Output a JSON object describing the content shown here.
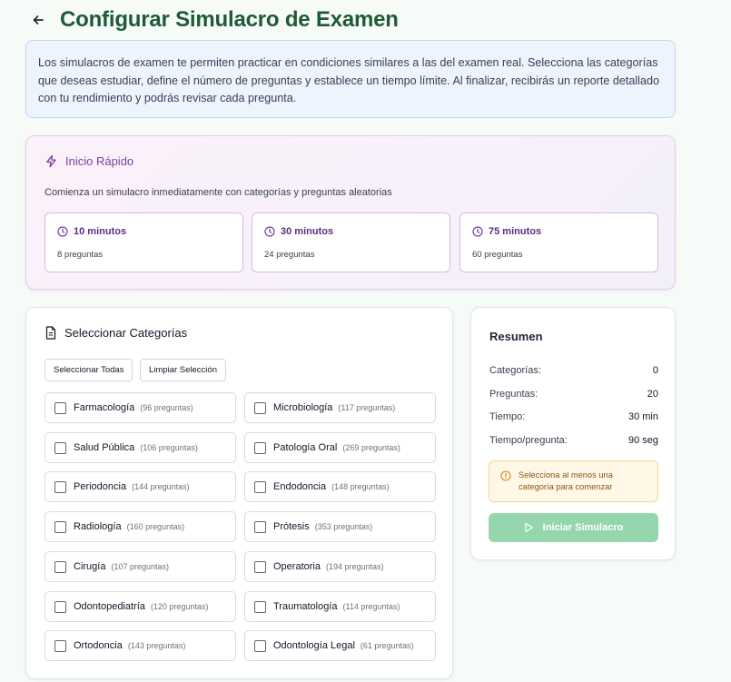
{
  "page": {
    "title": "Configurar Simulacro de Examen",
    "intro": "Los simulacros de examen te permiten practicar en condiciones similares a las del examen real. Selecciona las categorías que deseas estudiar, define el número de preguntas y establece un tiempo límite. Al finalizar, recibirás un reporte detallado con tu rendimiento y podrás revisar cada pregunta."
  },
  "quick_start": {
    "title": "Inicio Rápido",
    "subtitle": "Comienza un simulacro inmediatamente con categorías y preguntas aleatorias",
    "options": [
      {
        "label": "10 minutos",
        "questions": "8 preguntas"
      },
      {
        "label": "30 minutos",
        "questions": "24 preguntas"
      },
      {
        "label": "75 minutos",
        "questions": "60 preguntas"
      }
    ]
  },
  "categories": {
    "title": "Seleccionar Categorías",
    "select_all": "Seleccionar Todas",
    "clear": "Limpiar Selección",
    "items": [
      {
        "name": "Farmacología",
        "count": "(96 preguntas)"
      },
      {
        "name": "Microbiología",
        "count": "(117 preguntas)"
      },
      {
        "name": "Salud Pública",
        "count": "(106 preguntas)"
      },
      {
        "name": "Patología Oral",
        "count": "(269 preguntas)"
      },
      {
        "name": "Periodoncia",
        "count": "(144 preguntas)"
      },
      {
        "name": "Endodoncia",
        "count": "(148 preguntas)"
      },
      {
        "name": "Radiología",
        "count": "(160 preguntas)"
      },
      {
        "name": "Prótesis",
        "count": "(353 preguntas)"
      },
      {
        "name": "Cirugía",
        "count": "(107 preguntas)"
      },
      {
        "name": "Operatoria",
        "count": "(194 preguntas)"
      },
      {
        "name": "Odontopediatría",
        "count": "(120 preguntas)"
      },
      {
        "name": "Traumatología",
        "count": "(114 preguntas)"
      },
      {
        "name": "Ortodoncia",
        "count": "(143 preguntas)"
      },
      {
        "name": "Odontología Legal",
        "count": "(61 preguntas)"
      }
    ]
  },
  "summary": {
    "title": "Resumen",
    "rows": [
      {
        "label": "Categorías:",
        "value": "0"
      },
      {
        "label": "Preguntas:",
        "value": "20"
      },
      {
        "label": "Tiempo:",
        "value": "30 min"
      },
      {
        "label": "Tiempo/pregunta:",
        "value": "90 seg"
      }
    ],
    "warning": "Selecciona al menos una categoría para comenzar",
    "start_label": "Iniciar Simulacro"
  },
  "colors": {
    "title_green": "#1f5a38",
    "quick_purple": "#7b3fa3",
    "button_green_disabled": "#96d6ac",
    "warning_amber": "#d08a12"
  }
}
